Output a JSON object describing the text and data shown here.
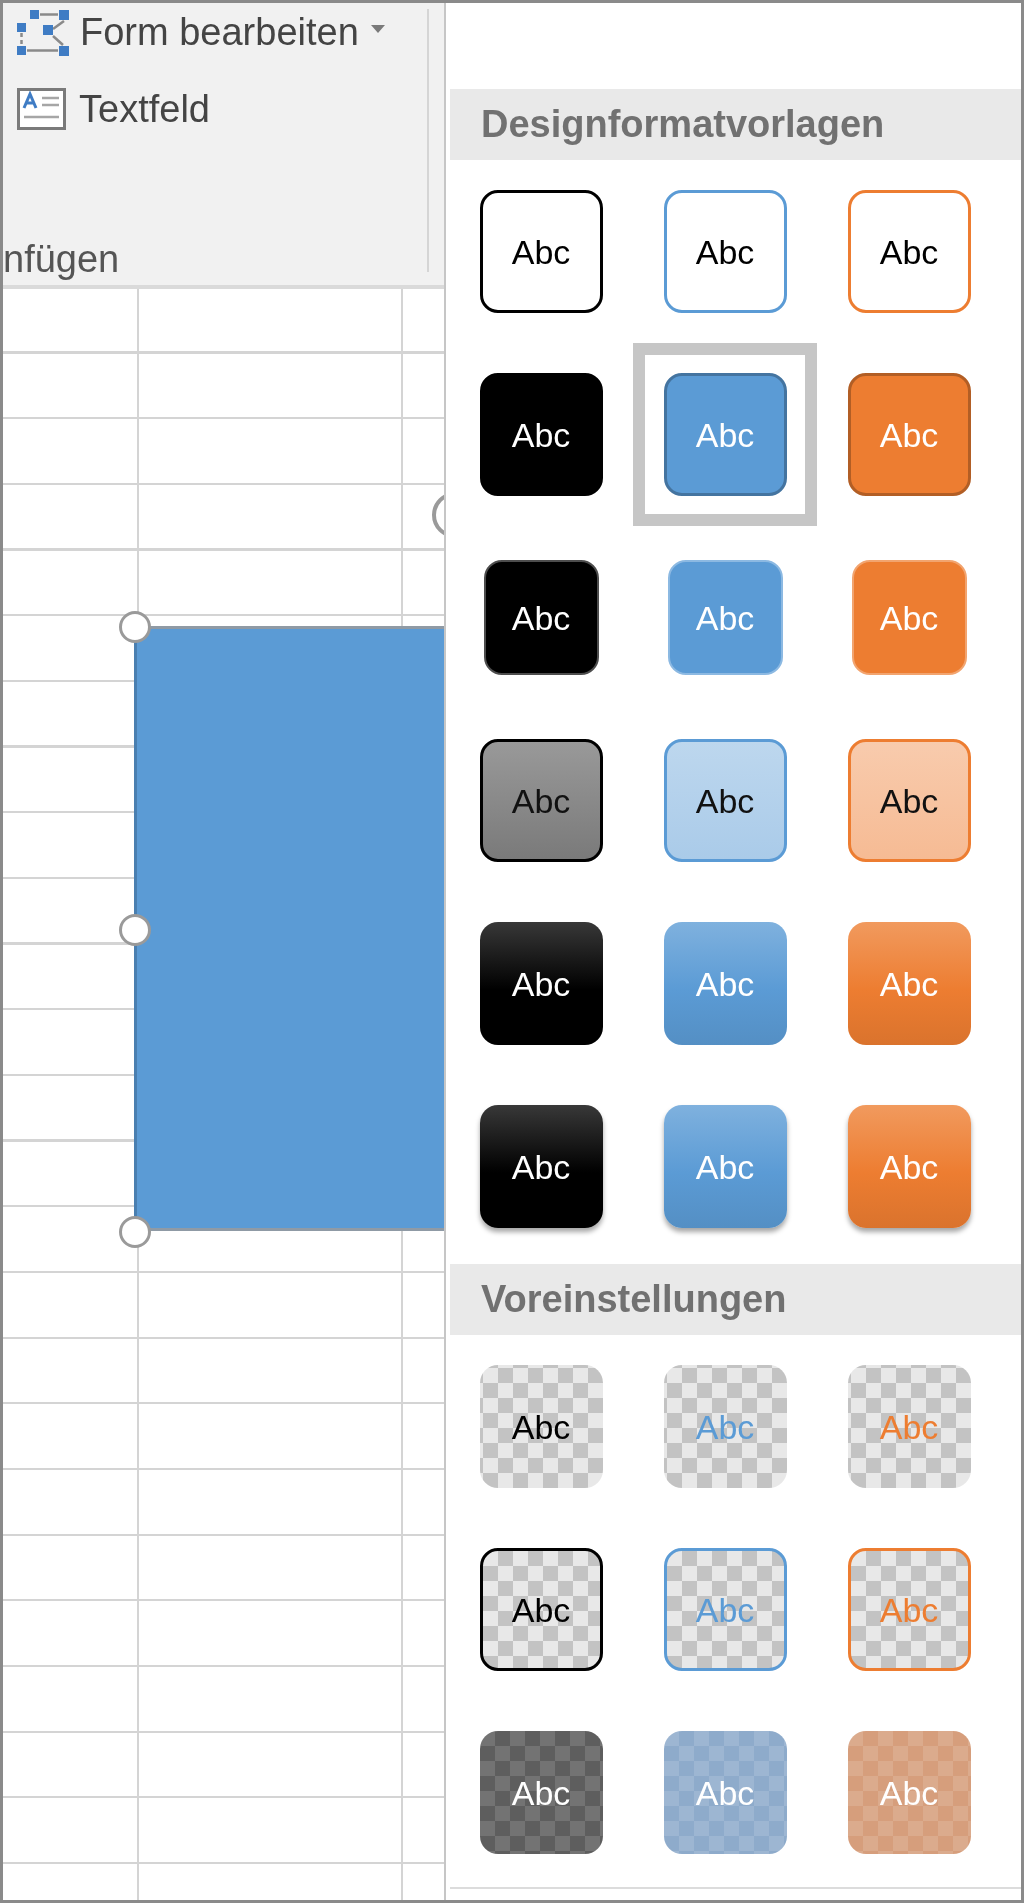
{
  "ribbon": {
    "commands": [
      {
        "label": "Form bearbeiten",
        "kind": "edit-shape",
        "dropdown": true
      },
      {
        "label": "Textfeld",
        "kind": "text-box",
        "dropdown": false
      }
    ],
    "group_label": "nfügen"
  },
  "sheet": {
    "shape": {
      "selected": true
    }
  },
  "gallery": {
    "sections": [
      {
        "title": "Designformatvorlagen",
        "rows": [
          {
            "kind": "outline",
            "tiles": [
              {
                "label": "Abc",
                "color": "#000000",
                "selected": false
              },
              {
                "label": "Abc",
                "color": "#5b9bd5",
                "selected": false
              },
              {
                "label": "Abc",
                "color": "#ed7d31",
                "selected": false
              }
            ]
          },
          {
            "kind": "fill",
            "tiles": [
              {
                "label": "Abc",
                "color": "#000000",
                "selected": false
              },
              {
                "label": "Abc",
                "color": "#5b9bd5",
                "selected": true
              },
              {
                "label": "Abc",
                "color": "#ed7d31",
                "selected": false
              }
            ]
          },
          {
            "kind": "subtle",
            "tiles": [
              {
                "label": "Abc",
                "color": "#000000",
                "selected": false
              },
              {
                "label": "Abc",
                "color": "#5b9bd5",
                "selected": false
              },
              {
                "label": "Abc",
                "color": "#ed7d31",
                "selected": false
              }
            ]
          },
          {
            "kind": "light",
            "tiles": [
              {
                "label": "Abc",
                "color": "#000000",
                "selected": false
              },
              {
                "label": "Abc",
                "color": "#5b9bd5",
                "selected": false
              },
              {
                "label": "Abc",
                "color": "#ed7d31",
                "selected": false
              }
            ]
          },
          {
            "kind": "gradient",
            "tiles": [
              {
                "label": "Abc",
                "color": "#000000",
                "selected": false
              },
              {
                "label": "Abc",
                "color": "#5b9bd5",
                "selected": false
              },
              {
                "label": "Abc",
                "color": "#ed7d31",
                "selected": false
              }
            ]
          },
          {
            "kind": "gradient-shadow",
            "tiles": [
              {
                "label": "Abc",
                "color": "#000000",
                "selected": false
              },
              {
                "label": "Abc",
                "color": "#5b9bd5",
                "selected": false
              },
              {
                "label": "Abc",
                "color": "#ed7d31",
                "selected": false
              }
            ]
          }
        ]
      },
      {
        "title": "Voreinstellungen",
        "rows": [
          {
            "kind": "transparent",
            "tiles": [
              {
                "label": "Abc",
                "color": "#000000",
                "selected": false
              },
              {
                "label": "Abc",
                "color": "#5b9bd5",
                "selected": false
              },
              {
                "label": "Abc",
                "color": "#ed7d31",
                "selected": false
              }
            ]
          },
          {
            "kind": "transparent-outline",
            "tiles": [
              {
                "label": "Abc",
                "color": "#000000",
                "selected": false
              },
              {
                "label": "Abc",
                "color": "#5b9bd5",
                "selected": false
              },
              {
                "label": "Abc",
                "color": "#ed7d31",
                "selected": false
              }
            ]
          },
          {
            "kind": "semi-transparent",
            "tiles": [
              {
                "label": "Abc",
                "color": "#5e5e5e",
                "selected": false
              },
              {
                "label": "Abc",
                "color": "#8eabcb",
                "selected": false
              },
              {
                "label": "Abc",
                "color": "#d69e7c",
                "selected": false
              }
            ]
          }
        ]
      }
    ]
  }
}
